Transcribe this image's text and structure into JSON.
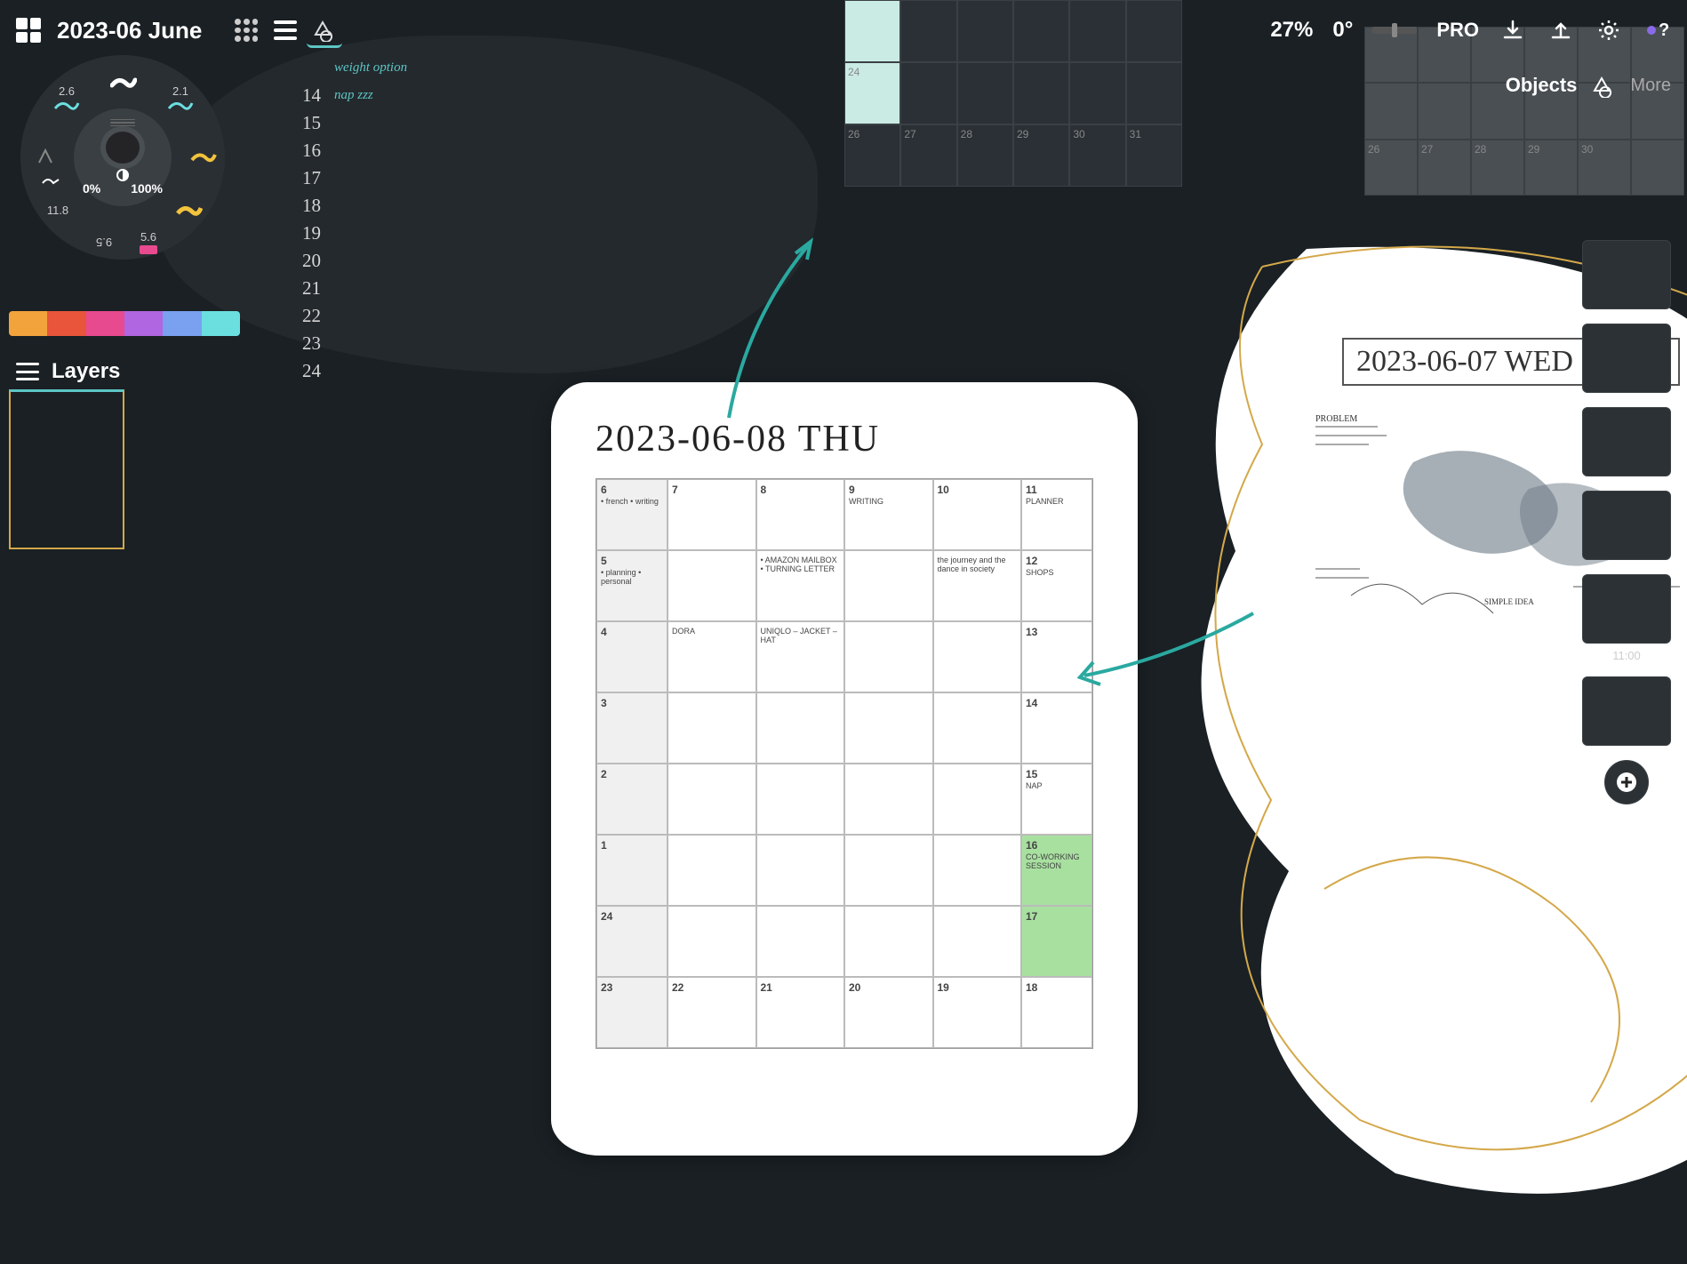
{
  "header": {
    "doc_title": "2023-06 June",
    "zoom": "27%",
    "angle": "0°",
    "pro": "PRO"
  },
  "subheader": {
    "objects": "Objects",
    "more": "More"
  },
  "wheel": {
    "pct_low": "0%",
    "pct_high": "100%",
    "sizes": [
      "2.6",
      "2.1",
      "11.8",
      "5.6",
      "9.5"
    ]
  },
  "palette": [
    "#f2a33c",
    "#e8553a",
    "#e84a8f",
    "#b066e0",
    "#7aa0f0",
    "#6bdfe0"
  ],
  "layers_label": "Layers",
  "numlist": [
    {
      "n": "14",
      "note": "nap zzz"
    },
    {
      "n": "15",
      "note": ""
    },
    {
      "n": "16",
      "note": ""
    },
    {
      "n": "17",
      "note": ""
    },
    {
      "n": "18",
      "note": ""
    },
    {
      "n": "19",
      "note": ""
    },
    {
      "n": "20",
      "note": ""
    },
    {
      "n": "21",
      "note": ""
    },
    {
      "n": "22",
      "note": ""
    },
    {
      "n": "23",
      "note": ""
    },
    {
      "n": "24",
      "note": ""
    }
  ],
  "numlist_header_note": "weight option",
  "minical_a_days": [
    "",
    "",
    "",
    "",
    "",
    "",
    "24",
    "",
    "",
    "",
    "",
    "",
    "26",
    "27",
    "28",
    "29",
    "30",
    "31"
  ],
  "minical_b_days": [
    "",
    "",
    "",
    "",
    "",
    "",
    "",
    "",
    "",
    "",
    "",
    "",
    "26",
    "27",
    "28",
    "29",
    "30",
    ""
  ],
  "page": {
    "title": "2023-06-08 THU",
    "cells_top": [
      {
        "n": "6",
        "txt": "• french\n• writing"
      },
      {
        "n": "7"
      },
      {
        "n": "8"
      },
      {
        "n": "9",
        "txt": "WRITING"
      },
      {
        "n": "10"
      },
      {
        "n": "11",
        "txt": "PLANNER"
      }
    ],
    "left_col": [
      "5",
      "4",
      "3",
      "2",
      "1",
      "24",
      "23"
    ],
    "left_notes": [
      "• planning\n• personal",
      "",
      "",
      "",
      "",
      "",
      ""
    ],
    "right_col": [
      "12",
      "13",
      "14",
      "15",
      "16",
      "17",
      "18"
    ],
    "right_notes": [
      "SHOPS",
      "",
      "",
      "NAP",
      "CO-WORKING\nSESSION",
      "",
      ""
    ],
    "bottom_row": [
      "22",
      "21",
      "20",
      "19"
    ],
    "mid_notes": [
      "• AMAZON MAILBOX\n• TURNING LETTER",
      "the journey\nand the dance\nin society",
      "UNIQLO – JACKET\n         – HAT",
      "DORA"
    ]
  },
  "page2": {
    "title": "2023-06-07 WED"
  },
  "thumb_label": "11:00"
}
